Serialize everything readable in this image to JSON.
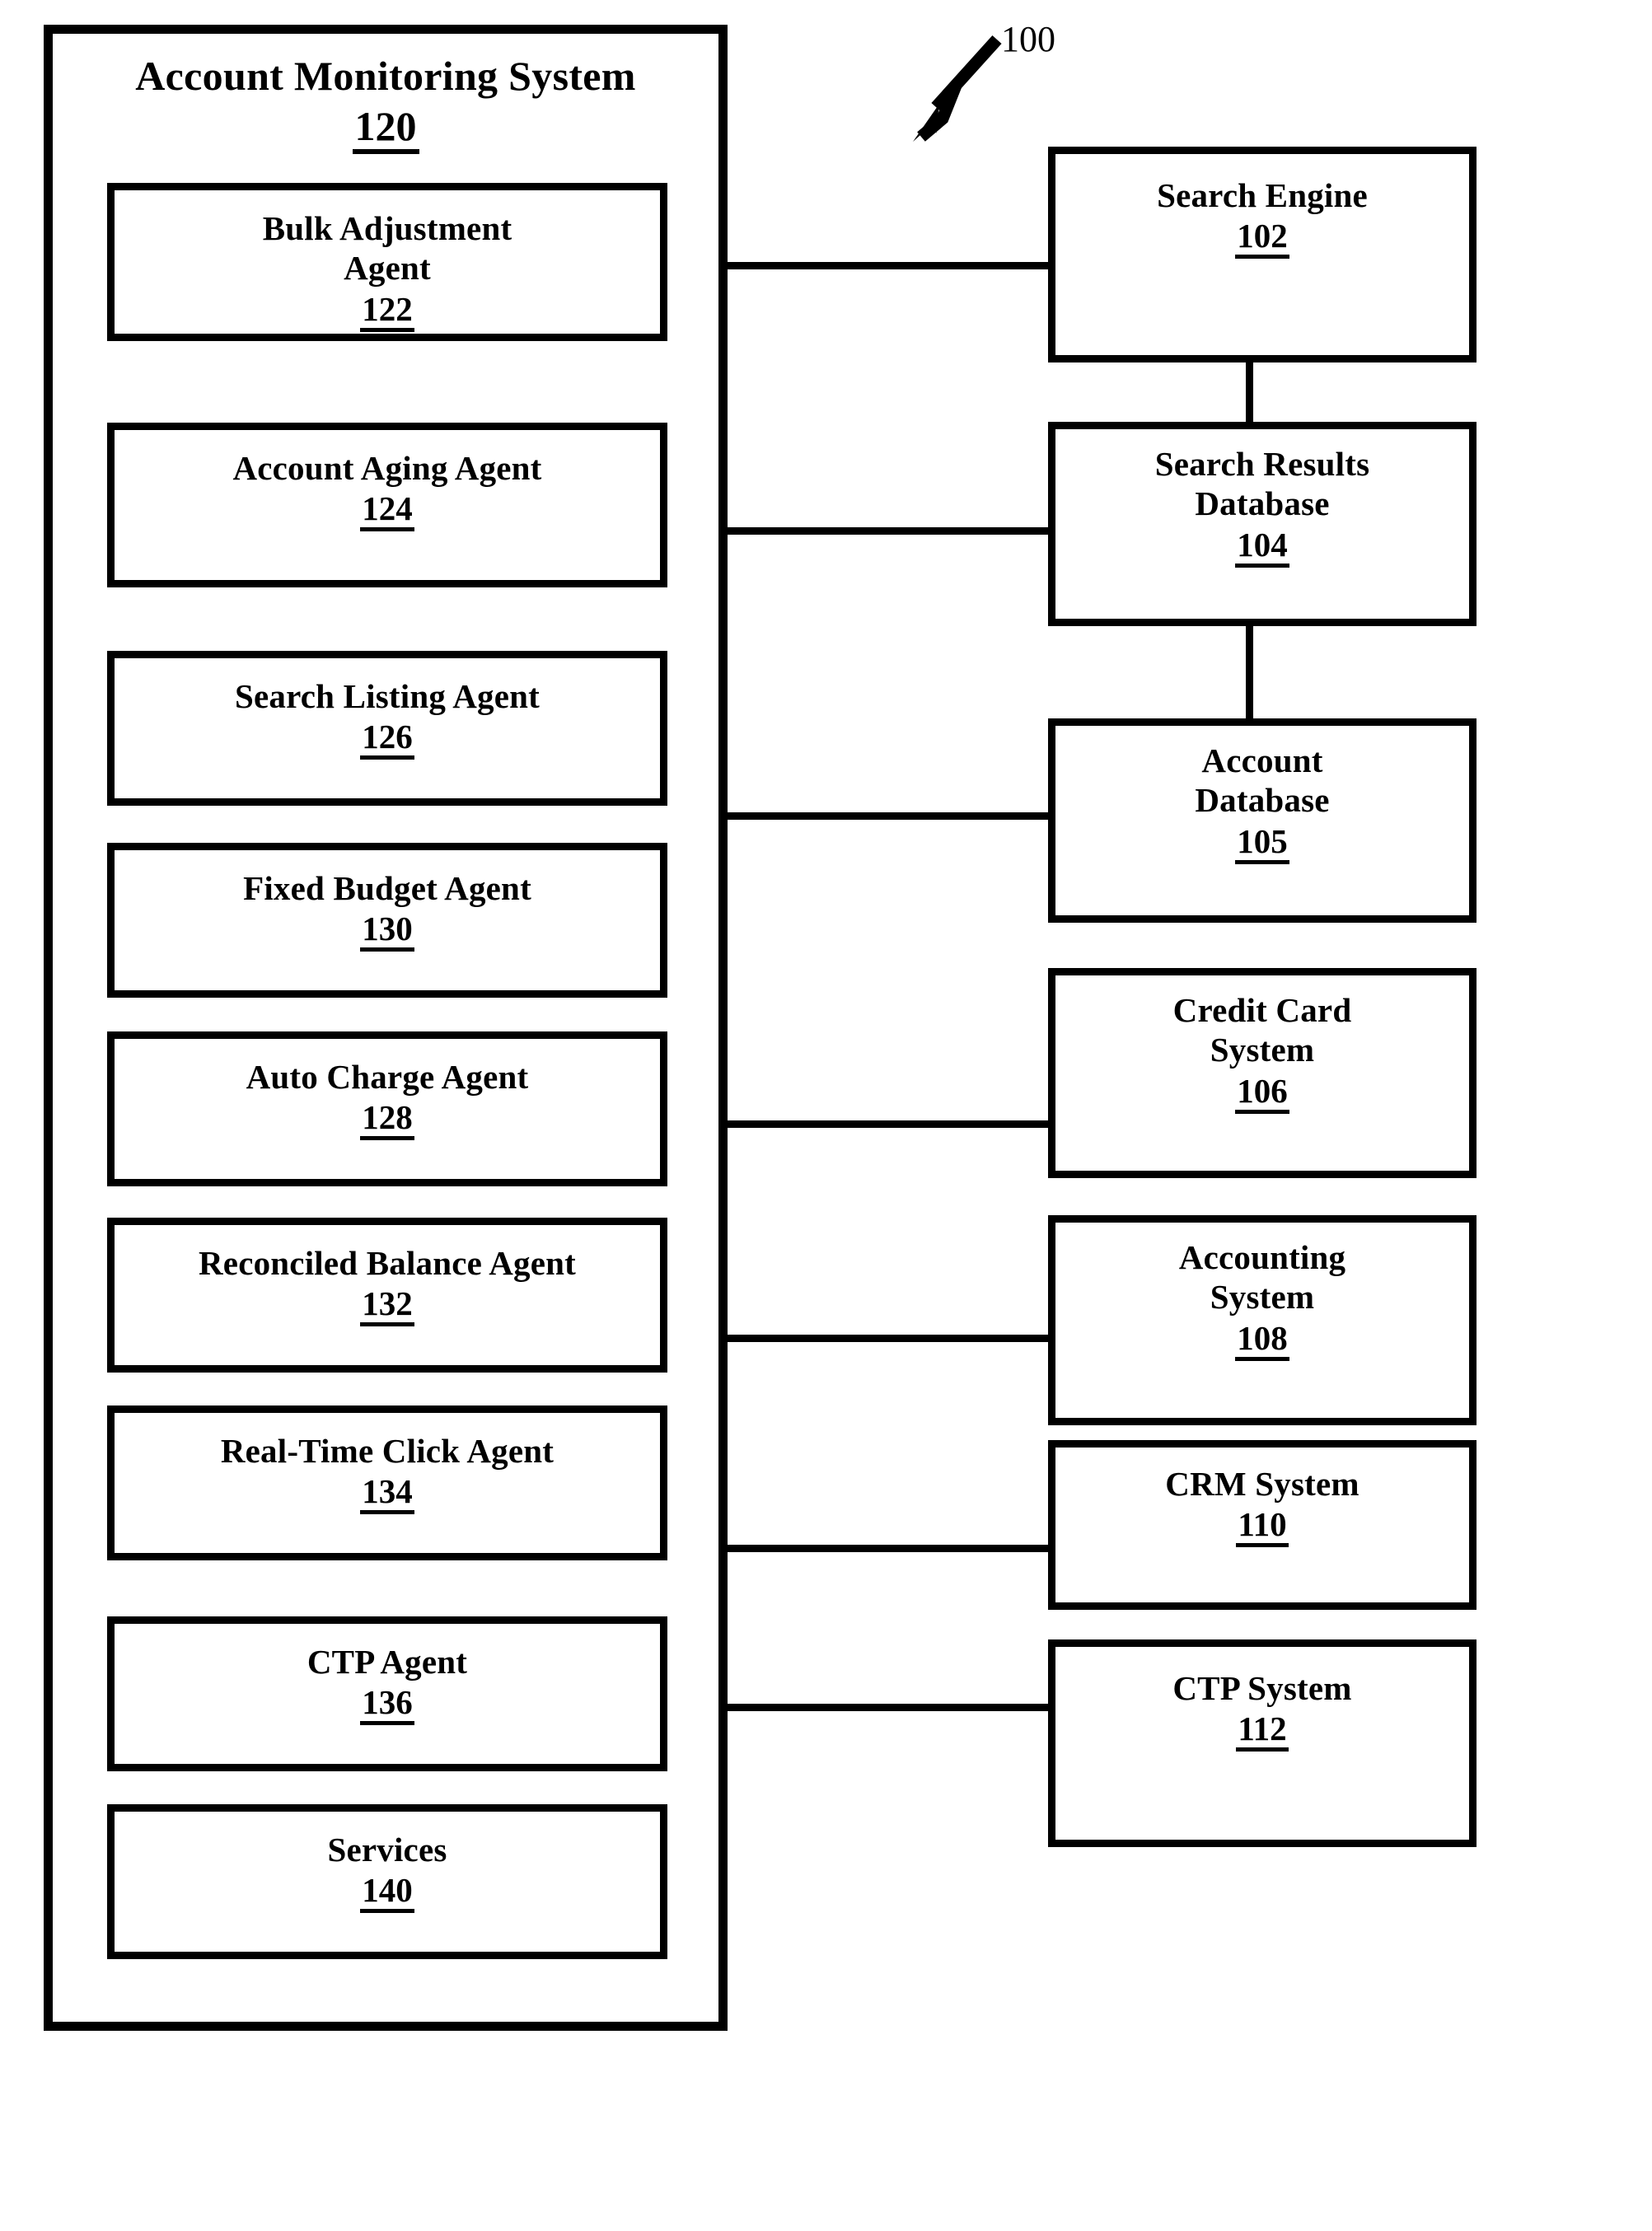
{
  "figure": {
    "reference_numeral": "100",
    "arrow_icon": "zigzag-arrow-down-left-icon"
  },
  "container": {
    "title": "Account Monitoring System",
    "ref": "120"
  },
  "agents": [
    {
      "title_line1": "Bulk Adjustment",
      "title_line2": "Agent",
      "ref": "122"
    },
    {
      "title_line1": "Account Aging Agent",
      "title_line2": "",
      "ref": "124"
    },
    {
      "title_line1": "Search Listing Agent",
      "title_line2": "",
      "ref": "126"
    },
    {
      "title_line1": "Fixed Budget Agent",
      "title_line2": "",
      "ref": "130"
    },
    {
      "title_line1": "Auto Charge Agent",
      "title_line2": "",
      "ref": "128"
    },
    {
      "title_line1": "Reconciled Balance Agent",
      "title_line2": "",
      "ref": "132"
    },
    {
      "title_line1": "Real-Time Click Agent",
      "title_line2": "",
      "ref": "134"
    },
    {
      "title_line1": "CTP Agent",
      "title_line2": "",
      "ref": "136"
    },
    {
      "title_line1": "Services",
      "title_line2": "",
      "ref": "140"
    }
  ],
  "systems": [
    {
      "title_line1": "Search Engine",
      "title_line2": "",
      "ref": "102"
    },
    {
      "title_line1": "Search Results",
      "title_line2": "Database",
      "ref": "104"
    },
    {
      "title_line1": "Account",
      "title_line2": "Database",
      "ref": "105"
    },
    {
      "title_line1": "Credit Card",
      "title_line2": "System",
      "ref": "106"
    },
    {
      "title_line1": "Accounting",
      "title_line2": "System",
      "ref": "108"
    },
    {
      "title_line1": "CRM System",
      "title_line2": "",
      "ref": "110"
    },
    {
      "title_line1": "CTP System",
      "title_line2": "",
      "ref": "112"
    }
  ],
  "colors": {
    "stroke": "#000000",
    "background": "#ffffff"
  }
}
